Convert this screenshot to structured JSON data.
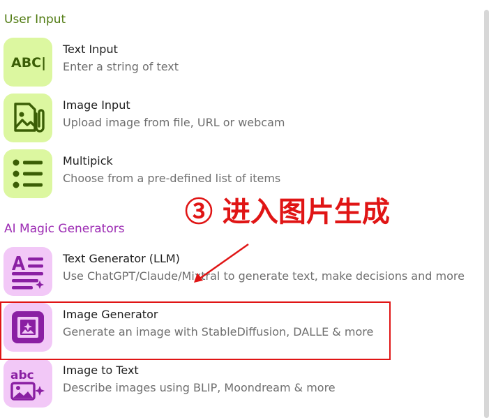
{
  "sections": {
    "user_input": {
      "title": "User Input",
      "items": [
        {
          "title": "Text Input",
          "description": "Enter a string of text",
          "icon": "text-input-icon",
          "icon_text": "ABC|"
        },
        {
          "title": "Image Input",
          "description": "Upload image from file, URL or webcam",
          "icon": "image-attach-icon"
        },
        {
          "title": "Multipick",
          "description": "Choose from a pre-defined list of items",
          "icon": "list-icon"
        }
      ]
    },
    "ai_magic": {
      "title": "AI Magic Generators",
      "items": [
        {
          "title": "Text Generator (LLM)",
          "description": "Use ChatGPT/Claude/Mixtral to generate text, make decisions and more",
          "icon": "text-sparkle-icon"
        },
        {
          "title": "Image Generator",
          "description": "Generate an image with StableDiffusion, DALLE & more",
          "icon": "image-sparkle-icon"
        },
        {
          "title": "Image to Text",
          "description": "Describe images using BLIP, Moondream & more",
          "icon": "image-to-text-icon",
          "icon_text": "abc"
        }
      ]
    }
  },
  "annotation": {
    "text": "③ 进入图片生成",
    "color": "#e01515"
  },
  "colors": {
    "green_heading": "#4f7a10",
    "purple_heading": "#9c2bb3",
    "green_tile": "#dcf7a0",
    "purple_tile": "#f2c8f7",
    "green_icon": "#3b5e06",
    "purple_icon": "#8a1fa3",
    "highlight": "#e01515"
  }
}
